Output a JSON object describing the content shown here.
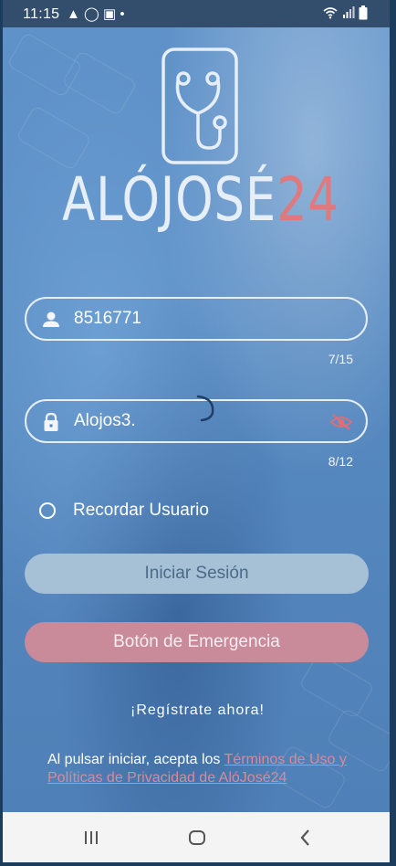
{
  "status_bar": {
    "time": "11:15",
    "notification_icons": [
      "warning-icon",
      "whatsapp-icon",
      "image-icon",
      "dot-icon"
    ],
    "right_icons": [
      "wifi-icon",
      "signal-icon",
      "battery-icon"
    ]
  },
  "logo": {
    "text_main": "ALÓJOSÉ",
    "text_num": "24",
    "icon": "stethoscope-phone-icon",
    "main_color": "#e6eef8",
    "accent_color": "#e0787e"
  },
  "user_field": {
    "icon": "person-icon",
    "value": "8516771",
    "counter": "7/15"
  },
  "password_field": {
    "icon": "lock-icon",
    "value": "Alojos3.",
    "counter": "8/12",
    "toggle_icon": "eye-off-icon"
  },
  "remember": {
    "label": "Recordar Usuario"
  },
  "buttons": {
    "login": "Iniciar Sesión",
    "emergency": "Botón de Emergencia"
  },
  "register": {
    "label": "¡Regístrate ahora!"
  },
  "terms": {
    "prefix": "Al pulsar iniciar, acepta los ",
    "link": "Términos de Uso y Políticas de Privacidad de AlóJosé24"
  },
  "nav_bar": {
    "items": [
      "recent-apps-icon",
      "home-icon",
      "back-icon"
    ]
  },
  "colors": {
    "background": "#5b8cc4",
    "status_bar": "#334e6d",
    "login_button": "#a6c0d6",
    "emergency_button": "#c98a9a",
    "link": "#d98a98"
  }
}
